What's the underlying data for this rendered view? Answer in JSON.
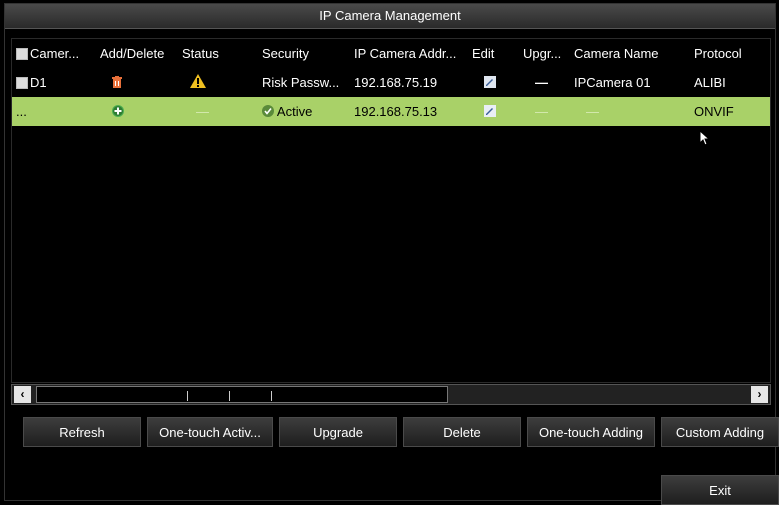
{
  "window": {
    "title": "IP Camera Management"
  },
  "table": {
    "headers": [
      "Camer...",
      "Add/Delete",
      "Status",
      "Security",
      "IP Camera Addr...",
      "Edit",
      "Upgr...",
      "Camera Name",
      "Protocol"
    ],
    "rows": [
      {
        "camera": "D1",
        "add_delete_icon": "delete-icon",
        "status_icon": "warning-icon",
        "security": "Risk Passw...",
        "ip": "192.168.75.19",
        "edit_icon": "edit-icon",
        "upgrade": "—",
        "camera_name": "IPCamera 01",
        "protocol": "ALIBI"
      },
      {
        "camera": "...",
        "add_delete_icon": "add-icon",
        "status": "—",
        "security_icon": "check-circle-icon",
        "security": "Active",
        "ip": "192.168.75.13",
        "edit_icon": "edit-icon",
        "upgrade": "—",
        "camera_name": "—",
        "protocol": "ONVIF"
      }
    ]
  },
  "buttons": {
    "refresh": "Refresh",
    "one_touch_activate": "One-touch Activ...",
    "upgrade": "Upgrade",
    "delete": "Delete",
    "one_touch_adding": "One-touch Adding",
    "custom_adding": "Custom Adding",
    "exit": "Exit"
  },
  "scrollbar": {
    "left_arrow": "‹",
    "right_arrow": "›"
  },
  "colors": {
    "selected_row": "#a9d168",
    "warning": "#f0c020",
    "delete_icon": "#e8703a",
    "add_icon": "#4caf50"
  }
}
